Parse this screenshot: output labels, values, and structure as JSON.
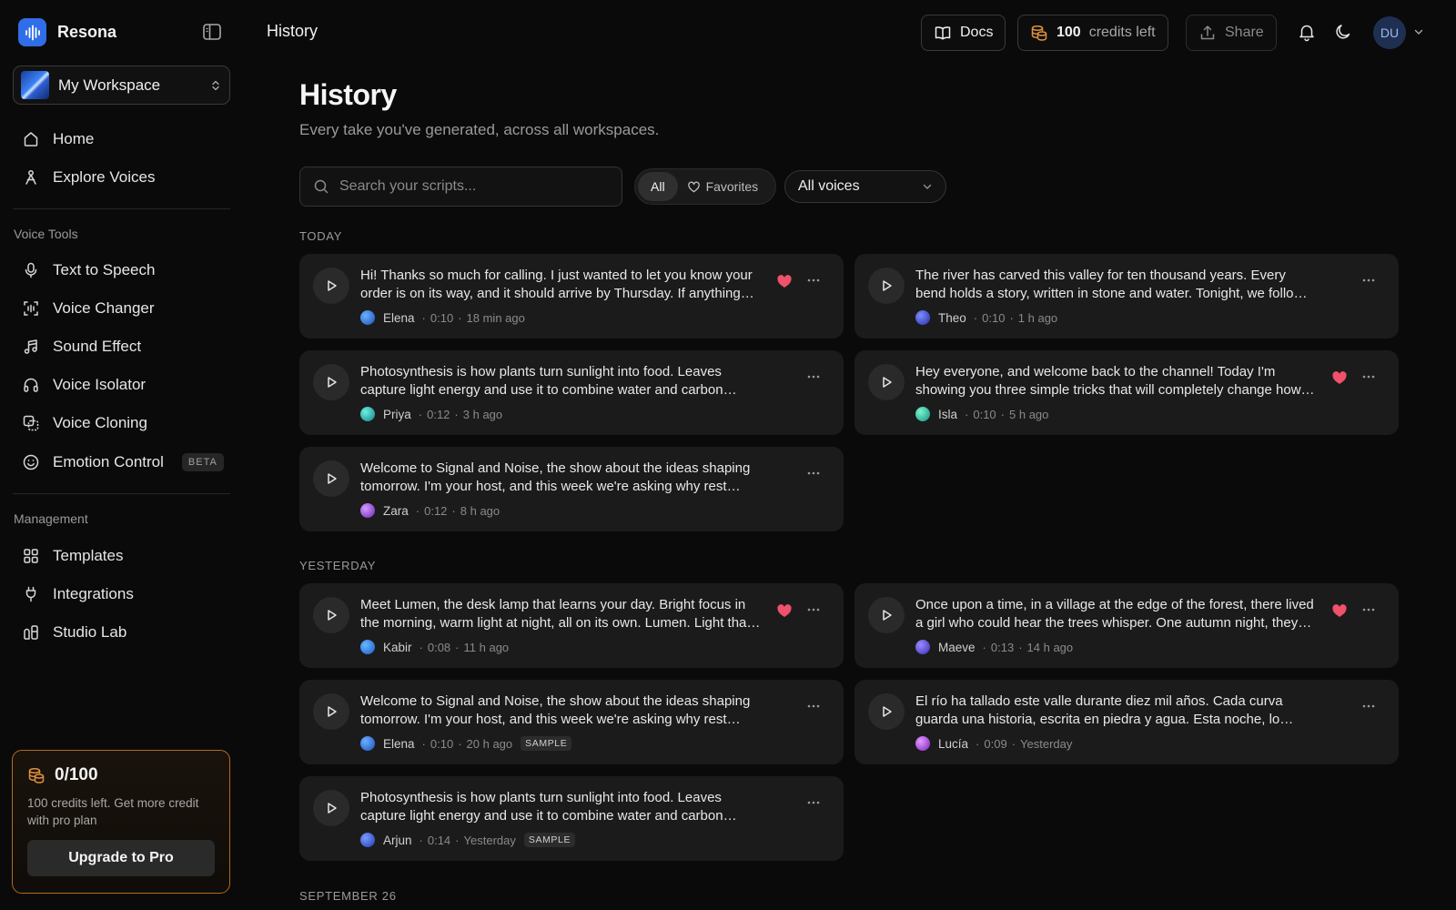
{
  "app": {
    "name": "Resona"
  },
  "workspace": {
    "name": "My Workspace"
  },
  "nav": {
    "top": [
      {
        "label": "Home",
        "icon": "home-icon"
      },
      {
        "label": "Explore Voices",
        "icon": "explore-icon"
      }
    ],
    "voice_tools_label": "Voice Tools",
    "voice_tools": [
      {
        "label": "Text to Speech",
        "icon": "mic-icon"
      },
      {
        "label": "Voice Changer",
        "icon": "voice-changer-icon"
      },
      {
        "label": "Sound Effect",
        "icon": "music-note-icon"
      },
      {
        "label": "Voice Isolator",
        "icon": "headphones-icon"
      },
      {
        "label": "Voice Cloning",
        "icon": "clone-icon"
      },
      {
        "label": "Emotion Control",
        "icon": "smile-icon",
        "badge": "BETA"
      }
    ],
    "management_label": "Management",
    "management": [
      {
        "label": "Templates",
        "icon": "grid-icon"
      },
      {
        "label": "Integrations",
        "icon": "plug-icon"
      },
      {
        "label": "Studio Lab",
        "icon": "lab-icon"
      }
    ]
  },
  "credits_card": {
    "count": "0/100",
    "text": "100 credits left. Get more credit with pro plan",
    "button": "Upgrade to Pro"
  },
  "topbar": {
    "title": "History",
    "docs": "Docs",
    "credits_number": "100",
    "credits_label": "credits left",
    "share": "Share",
    "avatar": "DU"
  },
  "page": {
    "title": "History",
    "subtitle": "Every take you've generated, across all workspaces."
  },
  "filters": {
    "search_placeholder": "Search your scripts...",
    "all": "All",
    "favorites": "Favorites",
    "voices": "All voices"
  },
  "colors": {
    "accent": "#2f6ee8",
    "heart": "#f0516b",
    "credit_border": "#b56a21"
  },
  "groups": [
    {
      "label": "TODAY",
      "items": [
        {
          "text": "Hi! Thanks so much for calling. I just wanted to let you know your order is on its way, and it should arrive by Thursday. If anything changes, we'll reach out right away.",
          "voice": "Elena",
          "duration": "0:10",
          "time": "18 min ago",
          "favorite": true,
          "sample": ""
        },
        {
          "text": "The river has carved this valley for ten thousand years. Every bend holds a story, written in stone and water. Tonight, we follow it from the source.",
          "voice": "Theo",
          "duration": "0:10",
          "time": "1 h ago",
          "favorite": false,
          "sample": ""
        },
        {
          "text": "Photosynthesis is how plants turn sunlight into food. Leaves capture light energy and use it to combine water and carbon dioxide into sugar.",
          "voice": "Priya",
          "duration": "0:12",
          "time": "3 h ago",
          "favorite": false,
          "sample": ""
        },
        {
          "text": "Hey everyone, and welcome back to the channel! Today I'm showing you three simple tricks that will completely change how you work.",
          "voice": "Isla",
          "duration": "0:10",
          "time": "5 h ago",
          "favorite": true,
          "sample": ""
        },
        {
          "text": "Welcome to Signal and Noise, the show about the ideas shaping tomorrow. I'm your host, and this week we're asking why rest might be productive.",
          "voice": "Zara",
          "duration": "0:12",
          "time": "8 h ago",
          "favorite": false,
          "sample": ""
        }
      ]
    },
    {
      "label": "YESTERDAY",
      "items": [
        {
          "text": "Meet Lumen, the desk lamp that learns your day. Bright focus in the morning, warm light at night, all on its own. Lumen. Light that thinks.",
          "voice": "Kabir",
          "duration": "0:08",
          "time": "11 h ago",
          "favorite": true,
          "sample": ""
        },
        {
          "text": "Once upon a time, in a village at the edge of the forest, there lived a girl who could hear the trees whisper. One autumn night, they called her name.",
          "voice": "Maeve",
          "duration": "0:13",
          "time": "14 h ago",
          "favorite": true,
          "sample": ""
        },
        {
          "text": "Welcome to Signal and Noise, the show about the ideas shaping tomorrow. I'm your host, and this week we're asking why rest might be productive.",
          "voice": "Elena",
          "duration": "0:10",
          "time": "20 h ago",
          "favorite": false,
          "sample": "SAMPLE"
        },
        {
          "text": "El río ha tallado este valle durante diez mil años. Cada curva guarda una historia, escrita en piedra y agua. Esta noche, lo seguimos.",
          "voice": "Lucía",
          "duration": "0:09",
          "time": "Yesterday",
          "favorite": false,
          "sample": ""
        },
        {
          "text": "Photosynthesis is how plants turn sunlight into food. Leaves capture light energy and use it to combine water and carbon dioxide into sugar.",
          "voice": "Arjun",
          "duration": "0:14",
          "time": "Yesterday",
          "favorite": false,
          "sample": "SAMPLE"
        }
      ]
    },
    {
      "label": "SEPTEMBER 26",
      "items": []
    }
  ]
}
